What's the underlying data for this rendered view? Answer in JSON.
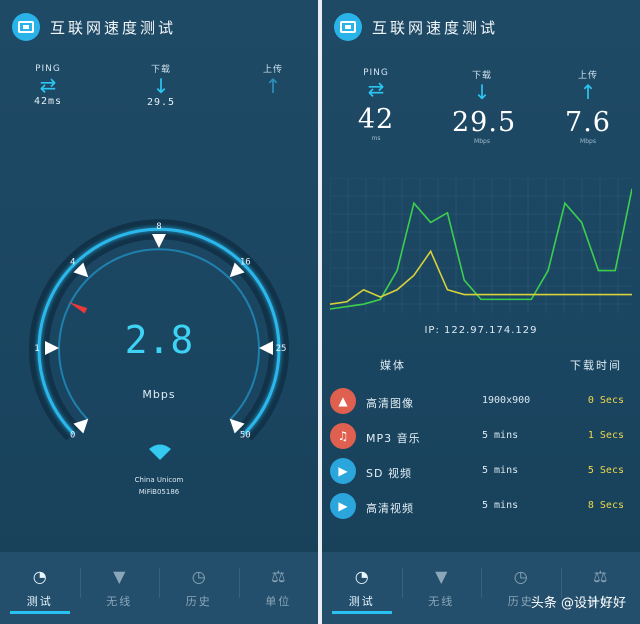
{
  "app": {
    "title": "互联网速度测试"
  },
  "left": {
    "stats": {
      "ping_label": "PING",
      "ping_value": "42ms",
      "down_label": "下载",
      "down_value": "29.5",
      "up_label": "上传"
    },
    "gauge": {
      "ticks": [
        "0",
        "1",
        "4",
        "8",
        "16",
        "25",
        "50"
      ],
      "needle_value": 2.8
    },
    "speed": "2.8",
    "unit": "Mbps",
    "network": {
      "carrier": "China Unicom",
      "ssid": "MiFiB05186"
    }
  },
  "right": {
    "stats": {
      "ping_label": "PING",
      "ping_value": "42",
      "ping_unit": "ms",
      "down_label": "下载",
      "down_value": "29.5",
      "down_unit": "Mbps",
      "up_label": "上传",
      "up_value": "7.6",
      "up_unit": "Mbps"
    },
    "ip": "IP: 122.97.174.129",
    "table": {
      "col_media": "媒体",
      "col_time": "下载时间",
      "rows": [
        {
          "name": "高清图像",
          "size": "1900x900",
          "time": "0 Secs",
          "icon": "image-icon",
          "color": "#e0604f"
        },
        {
          "name": "MP3 音乐",
          "size": "5 mins",
          "time": "1 Secs",
          "icon": "music-icon",
          "color": "#e0604f"
        },
        {
          "name": "SD 视频",
          "size": "5 mins",
          "time": "5 Secs",
          "icon": "video-icon",
          "color": "#2aa6dc"
        },
        {
          "name": "高清视频",
          "size": "5 mins",
          "time": "8 Secs",
          "icon": "video-icon",
          "color": "#2aa6dc"
        }
      ]
    }
  },
  "tabs": [
    {
      "label": "测试",
      "icon": "speedometer-icon"
    },
    {
      "label": "无线",
      "icon": "wifi-icon"
    },
    {
      "label": "历史",
      "icon": "history-icon"
    },
    {
      "label": "单位",
      "icon": "scale-icon"
    }
  ],
  "watermark": "头条 @设计好好",
  "chart_data": {
    "type": "line",
    "series": [
      {
        "color": "#3ccf4e",
        "values": [
          0,
          0.5,
          1,
          2,
          8,
          22,
          18,
          20,
          6,
          2,
          2,
          2,
          2,
          8,
          22,
          18,
          8,
          8,
          25
        ]
      },
      {
        "color": "#d8d23a",
        "values": [
          1,
          1.5,
          4,
          2.5,
          4,
          7,
          12,
          4,
          3,
          3,
          3,
          3,
          3,
          3,
          3,
          3,
          3,
          3,
          3
        ]
      }
    ],
    "grid": true,
    "colors": {
      "accent": "#2cc6f3",
      "speed": "#3ed3f4",
      "time": "#f1d84a"
    }
  }
}
